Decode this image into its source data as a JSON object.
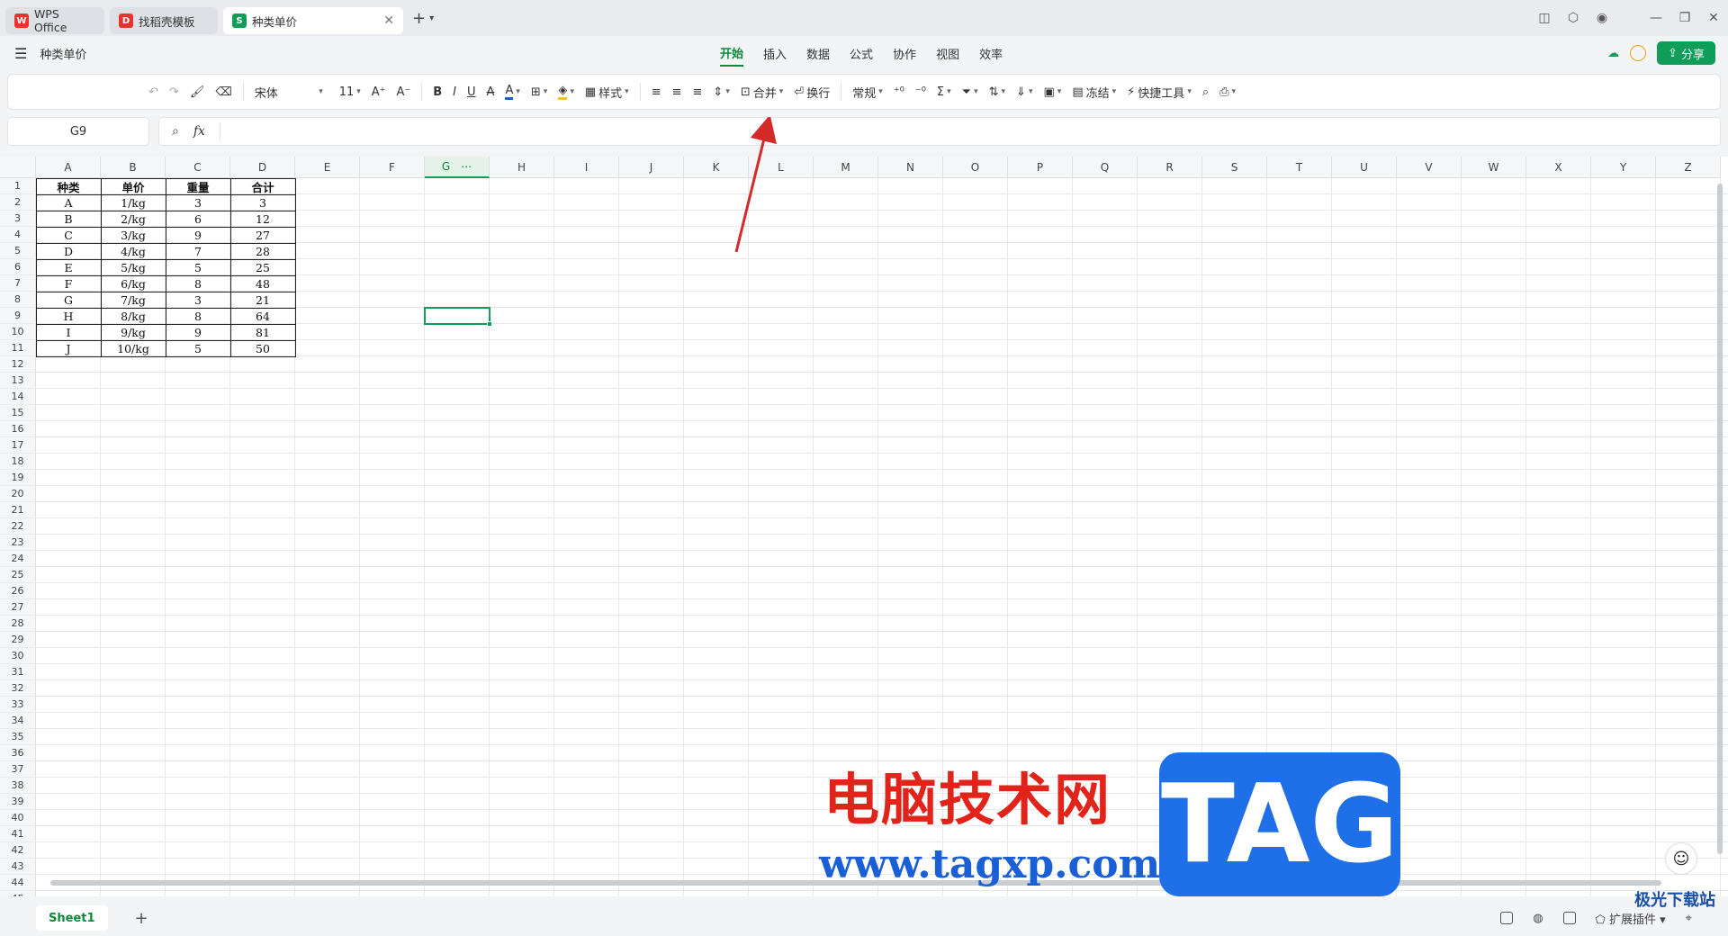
{
  "titlebar": {
    "tabs": [
      {
        "label": "WPS Office",
        "logo": "W",
        "logo_color": "#e8322d"
      },
      {
        "label": "找稻壳模板",
        "logo": "D",
        "logo_color": "#e8322d"
      },
      {
        "label": "种类单价",
        "logo": "S",
        "logo_color": "#0f9d58",
        "active": true
      }
    ],
    "new_tab": "+"
  },
  "menubar": {
    "doc_name": "种类单价",
    "menus": [
      "开始",
      "插入",
      "数据",
      "公式",
      "协作",
      "视图",
      "效率"
    ],
    "active_menu": "开始",
    "share_label": "分享"
  },
  "toolbar": {
    "font_name": "宋体",
    "font_size": "11",
    "style_label": "样式",
    "merge_label": "合并",
    "wrap_label": "换行",
    "number_format": "常规",
    "freeze_label": "冻结",
    "quick_tools_label": "快捷工具"
  },
  "formula_bar": {
    "cell_ref": "G9",
    "fx_label": "fx",
    "value": ""
  },
  "sheet": {
    "columns": [
      "A",
      "B",
      "C",
      "D",
      "E",
      "F",
      "G",
      "H",
      "I",
      "J",
      "K",
      "L",
      "M",
      "N",
      "O",
      "P",
      "Q",
      "R",
      "S",
      "T",
      "U",
      "V",
      "W",
      "X",
      "Y",
      "Z"
    ],
    "selected_column": "G",
    "row_count": 45,
    "table_header": [
      "种类",
      "单价",
      "重量",
      "合计"
    ],
    "table_rows": [
      [
        "A",
        "1/kg",
        "3",
        "3"
      ],
      [
        "B",
        "2/kg",
        "6",
        "12"
      ],
      [
        "C",
        "3/kg",
        "9",
        "27"
      ],
      [
        "D",
        "4/kg",
        "7",
        "28"
      ],
      [
        "E",
        "5/kg",
        "5",
        "25"
      ],
      [
        "F",
        "6/kg",
        "8",
        "48"
      ],
      [
        "G",
        "7/kg",
        "3",
        "21"
      ],
      [
        "H",
        "8/kg",
        "8",
        "64"
      ],
      [
        "I",
        "9/kg",
        "9",
        "81"
      ],
      [
        "J",
        "10/kg",
        "5",
        "50"
      ]
    ],
    "selected_cell": "G9"
  },
  "statusbar": {
    "sheet_tab": "Sheet1",
    "add_sheet": "+",
    "plugins_label": "扩展插件"
  },
  "watermark": {
    "text": "电脑技术网",
    "url": "www.tagxp.com",
    "tag": "TAG",
    "corner": "极光下载站"
  },
  "colors": {
    "accent": "#0f9d58",
    "arrow": "#d42a2a"
  }
}
